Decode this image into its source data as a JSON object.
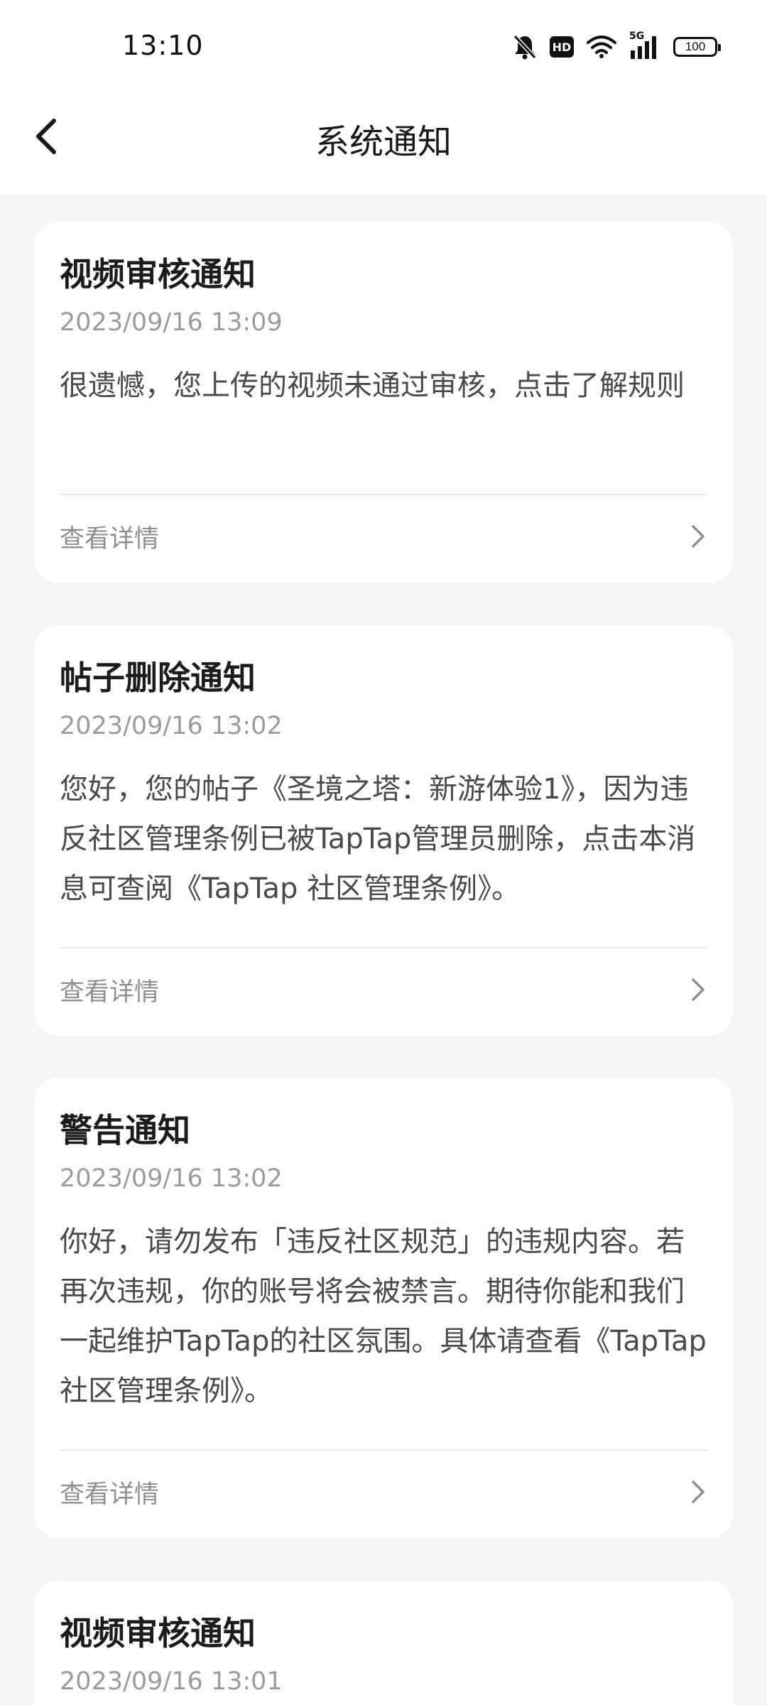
{
  "status_bar": {
    "time": "13:10",
    "hd": "HD",
    "network": "5G",
    "battery": "100",
    "icons": [
      "mute-bell-icon",
      "hd-icon",
      "wifi-icon",
      "5g-signal-icon",
      "battery-icon"
    ]
  },
  "header": {
    "title": "系统通知",
    "back_icon": "back-arrow-icon"
  },
  "notifications": [
    {
      "title": "视频审核通知",
      "time": "2023/09/16 13:09",
      "body": "很遗憾，您上传的视频未通过审核，点击了解规则",
      "action": "查看详情"
    },
    {
      "title": "帖子删除通知",
      "time": "2023/09/16 13:02",
      "body": "您好，您的帖子《圣境之塔：新游体验1》，因为违反社区管理条例已被TapTap管理员删除，点击本消息可查阅《TapTap 社区管理条例》。",
      "action": "查看详情"
    },
    {
      "title": "警告通知",
      "time": "2023/09/16 13:02",
      "body": "你好，请勿发布「违反社区规范」的违规内容。若再次违规，你的账号将会被禁言。期待你能和我们一起维护TapTap的社区氛围。具体请查看《TapTap 社区管理条例》。",
      "action": "查看详情"
    },
    {
      "title": "视频审核通知",
      "time": "2023/09/16 13:01"
    }
  ],
  "colors": {
    "page_background": "#f4f5f7",
    "card_background": "#ffffff",
    "title_text": "#1c1c1c",
    "secondary_text": "#9a9ca0"
  }
}
